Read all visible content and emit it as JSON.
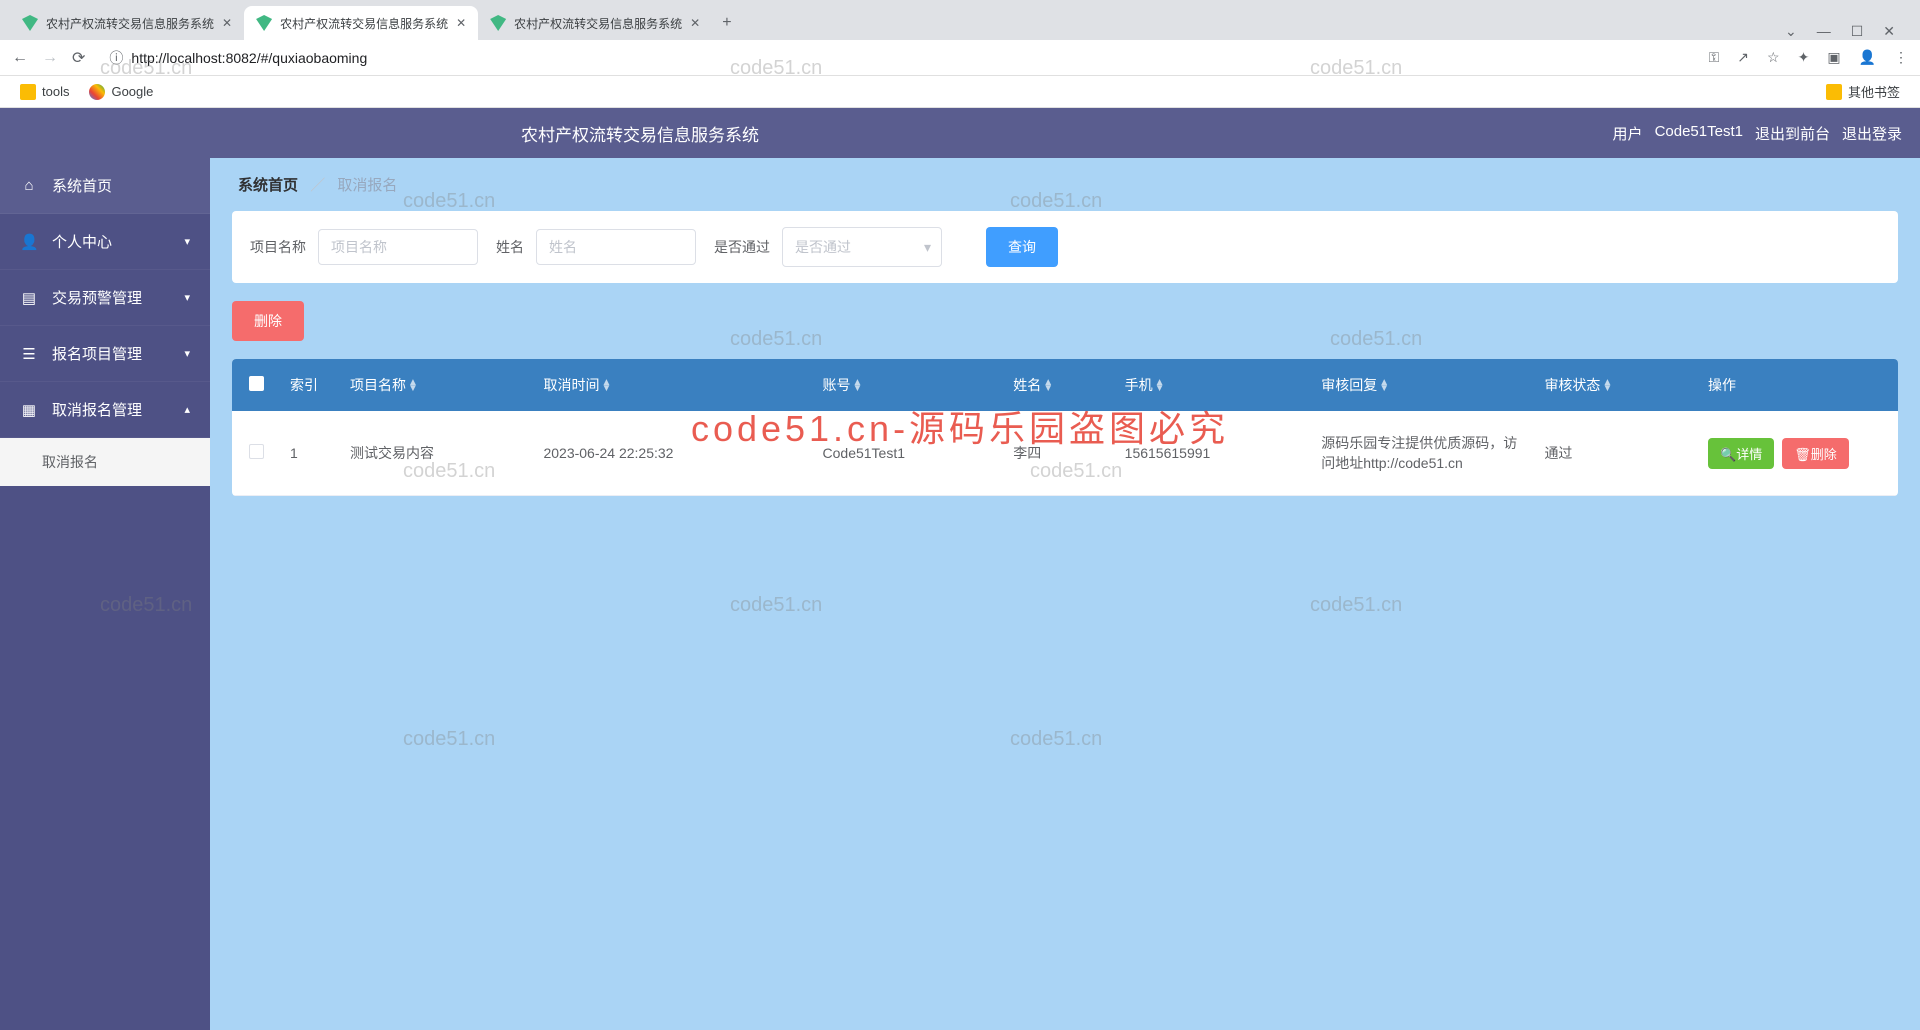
{
  "browser": {
    "tabs": [
      {
        "title": "农村产权流转交易信息服务系统"
      },
      {
        "title": "农村产权流转交易信息服务系统"
      },
      {
        "title": "农村产权流转交易信息服务系统"
      }
    ],
    "url_prefix": "ⓘ",
    "url": "http://localhost:8082/#/quxiaobaoming",
    "bookmarks": {
      "tools": "tools",
      "google": "Google",
      "other": "其他书签"
    }
  },
  "header": {
    "system_title": "农村产权流转交易信息服务系统",
    "user_prefix": "用户",
    "user_name": "Code51Test1",
    "exit_front": "退出到前台",
    "logout": "退出登录"
  },
  "sidebar": {
    "home": "系统首页",
    "personal": "个人中心",
    "alert": "交易预警管理",
    "signup": "报名项目管理",
    "cancel_mgmt": "取消报名管理",
    "cancel_sub": "取消报名"
  },
  "breadcrumb": {
    "home": "系统首页",
    "current": "取消报名"
  },
  "search": {
    "project_label": "项目名称",
    "project_ph": "项目名称",
    "name_label": "姓名",
    "name_ph": "姓名",
    "pass_label": "是否通过",
    "pass_ph": "是否通过",
    "query_btn": "查询",
    "delete_btn": "删除"
  },
  "table": {
    "headers": {
      "index": "索引",
      "project": "项目名称",
      "cancel_time": "取消时间",
      "account": "账号",
      "name": "姓名",
      "phone": "手机",
      "reply": "审核回复",
      "status": "审核状态",
      "action": "操作"
    },
    "rows": [
      {
        "index": "1",
        "project": "测试交易内容",
        "cancel_time": "2023-06-24 22:25:32",
        "account": "Code51Test1",
        "name": "李四",
        "phone": "15615615991",
        "reply": "源码乐园专注提供优质源码，访问地址http://code51.cn",
        "status": "通过"
      }
    ],
    "detail_btn": "详情",
    "row_delete_btn": "删除"
  },
  "watermarks": {
    "text": "code51.cn",
    "big": "code51.cn-源码乐园盗图必究"
  }
}
